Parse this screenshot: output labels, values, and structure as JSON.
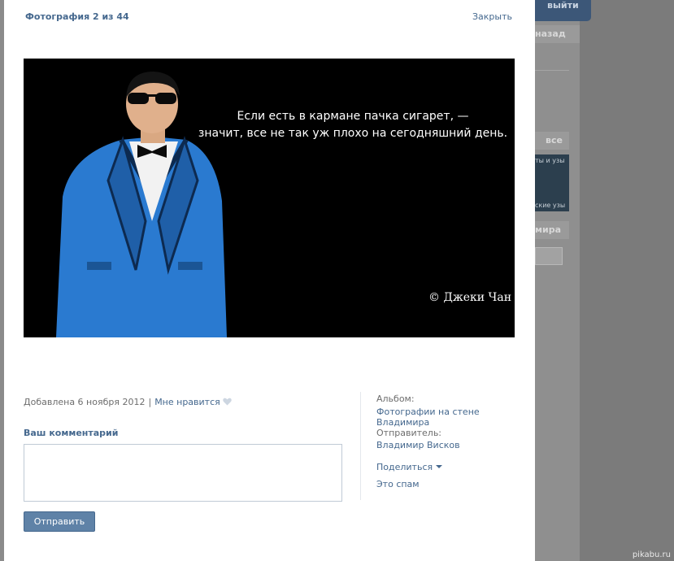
{
  "background": {
    "logout_label": "выйти",
    "back_label": "назад",
    "all_label": "все",
    "thumb_top_text": "ты и узы",
    "thumb_bottom_text": "ские узы",
    "box_label": "мира",
    "watermark": "pikabu.ru"
  },
  "modal": {
    "title": "Фотография 2 из 44",
    "close_label": "Закрыть"
  },
  "photo": {
    "quote_line1": "Если есть в кармане пачка сигарет, —",
    "quote_line2": "значит, все не так уж плохо на сегодняшний день.",
    "quote_author": "© Джеки Чан"
  },
  "info": {
    "added": "Добавлена 6 ноября 2012",
    "separator": "|",
    "like_label": "Мне нравится"
  },
  "comment": {
    "label": "Ваш комментарий",
    "value": "",
    "send_label": "Отправить"
  },
  "side": {
    "album_label": "Альбом:",
    "album_value": "Фотографии на стене Владимира",
    "sender_label": "Отправитель:",
    "sender_value": "Владимир Висков",
    "share_label": "Поделиться",
    "spam_label": "Это спам"
  },
  "colors": {
    "link": "#45688e",
    "button": "#5f82a7",
    "suit": "#2a7ad0"
  }
}
